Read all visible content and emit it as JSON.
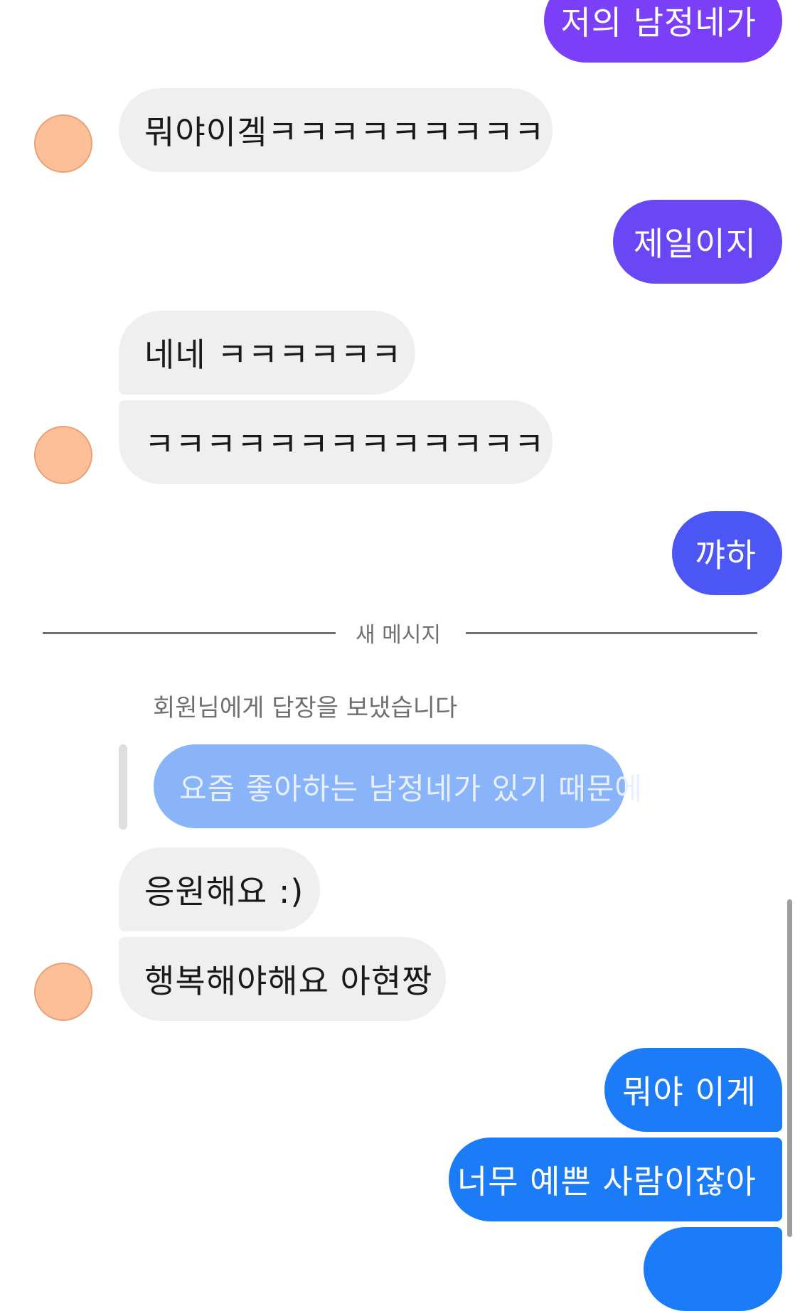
{
  "colors": {
    "outgoing_purple_dark": "#7b3ff7",
    "outgoing_purple": "#6a47f5",
    "outgoing_indigo": "#4c56f5",
    "outgoing_blue": "#1c7bf7",
    "incoming_gray": "#efefef",
    "reply_preview_blue": "#89b4fa",
    "avatar_peach": "#fcbf98"
  },
  "messages": {
    "m1": "저의 남정네가",
    "m2": "뭐야이겤ㅋㅋㅋㅋㅋㅋㅋㅋㅋ",
    "m3": "제일이지",
    "m4": "네네 ㅋㅋㅋㅋㅋㅋ",
    "m5": "ㅋㅋㅋㅋㅋㅋㅋㅋㅋㅋㅋㅋㅋ",
    "m6": "꺄하",
    "m7": "응원해요 :)",
    "m8": "행복해야해요 아현짱",
    "m9": "뭐야 이게",
    "m10": "너무 예쁜 사람이잖아"
  },
  "divider": {
    "label": "새 메시지"
  },
  "reply": {
    "caption": "회원님에게 답장을 보냈습니다",
    "quoted_text": "요즘 좋아하는 남정네가 있기 때문에"
  }
}
